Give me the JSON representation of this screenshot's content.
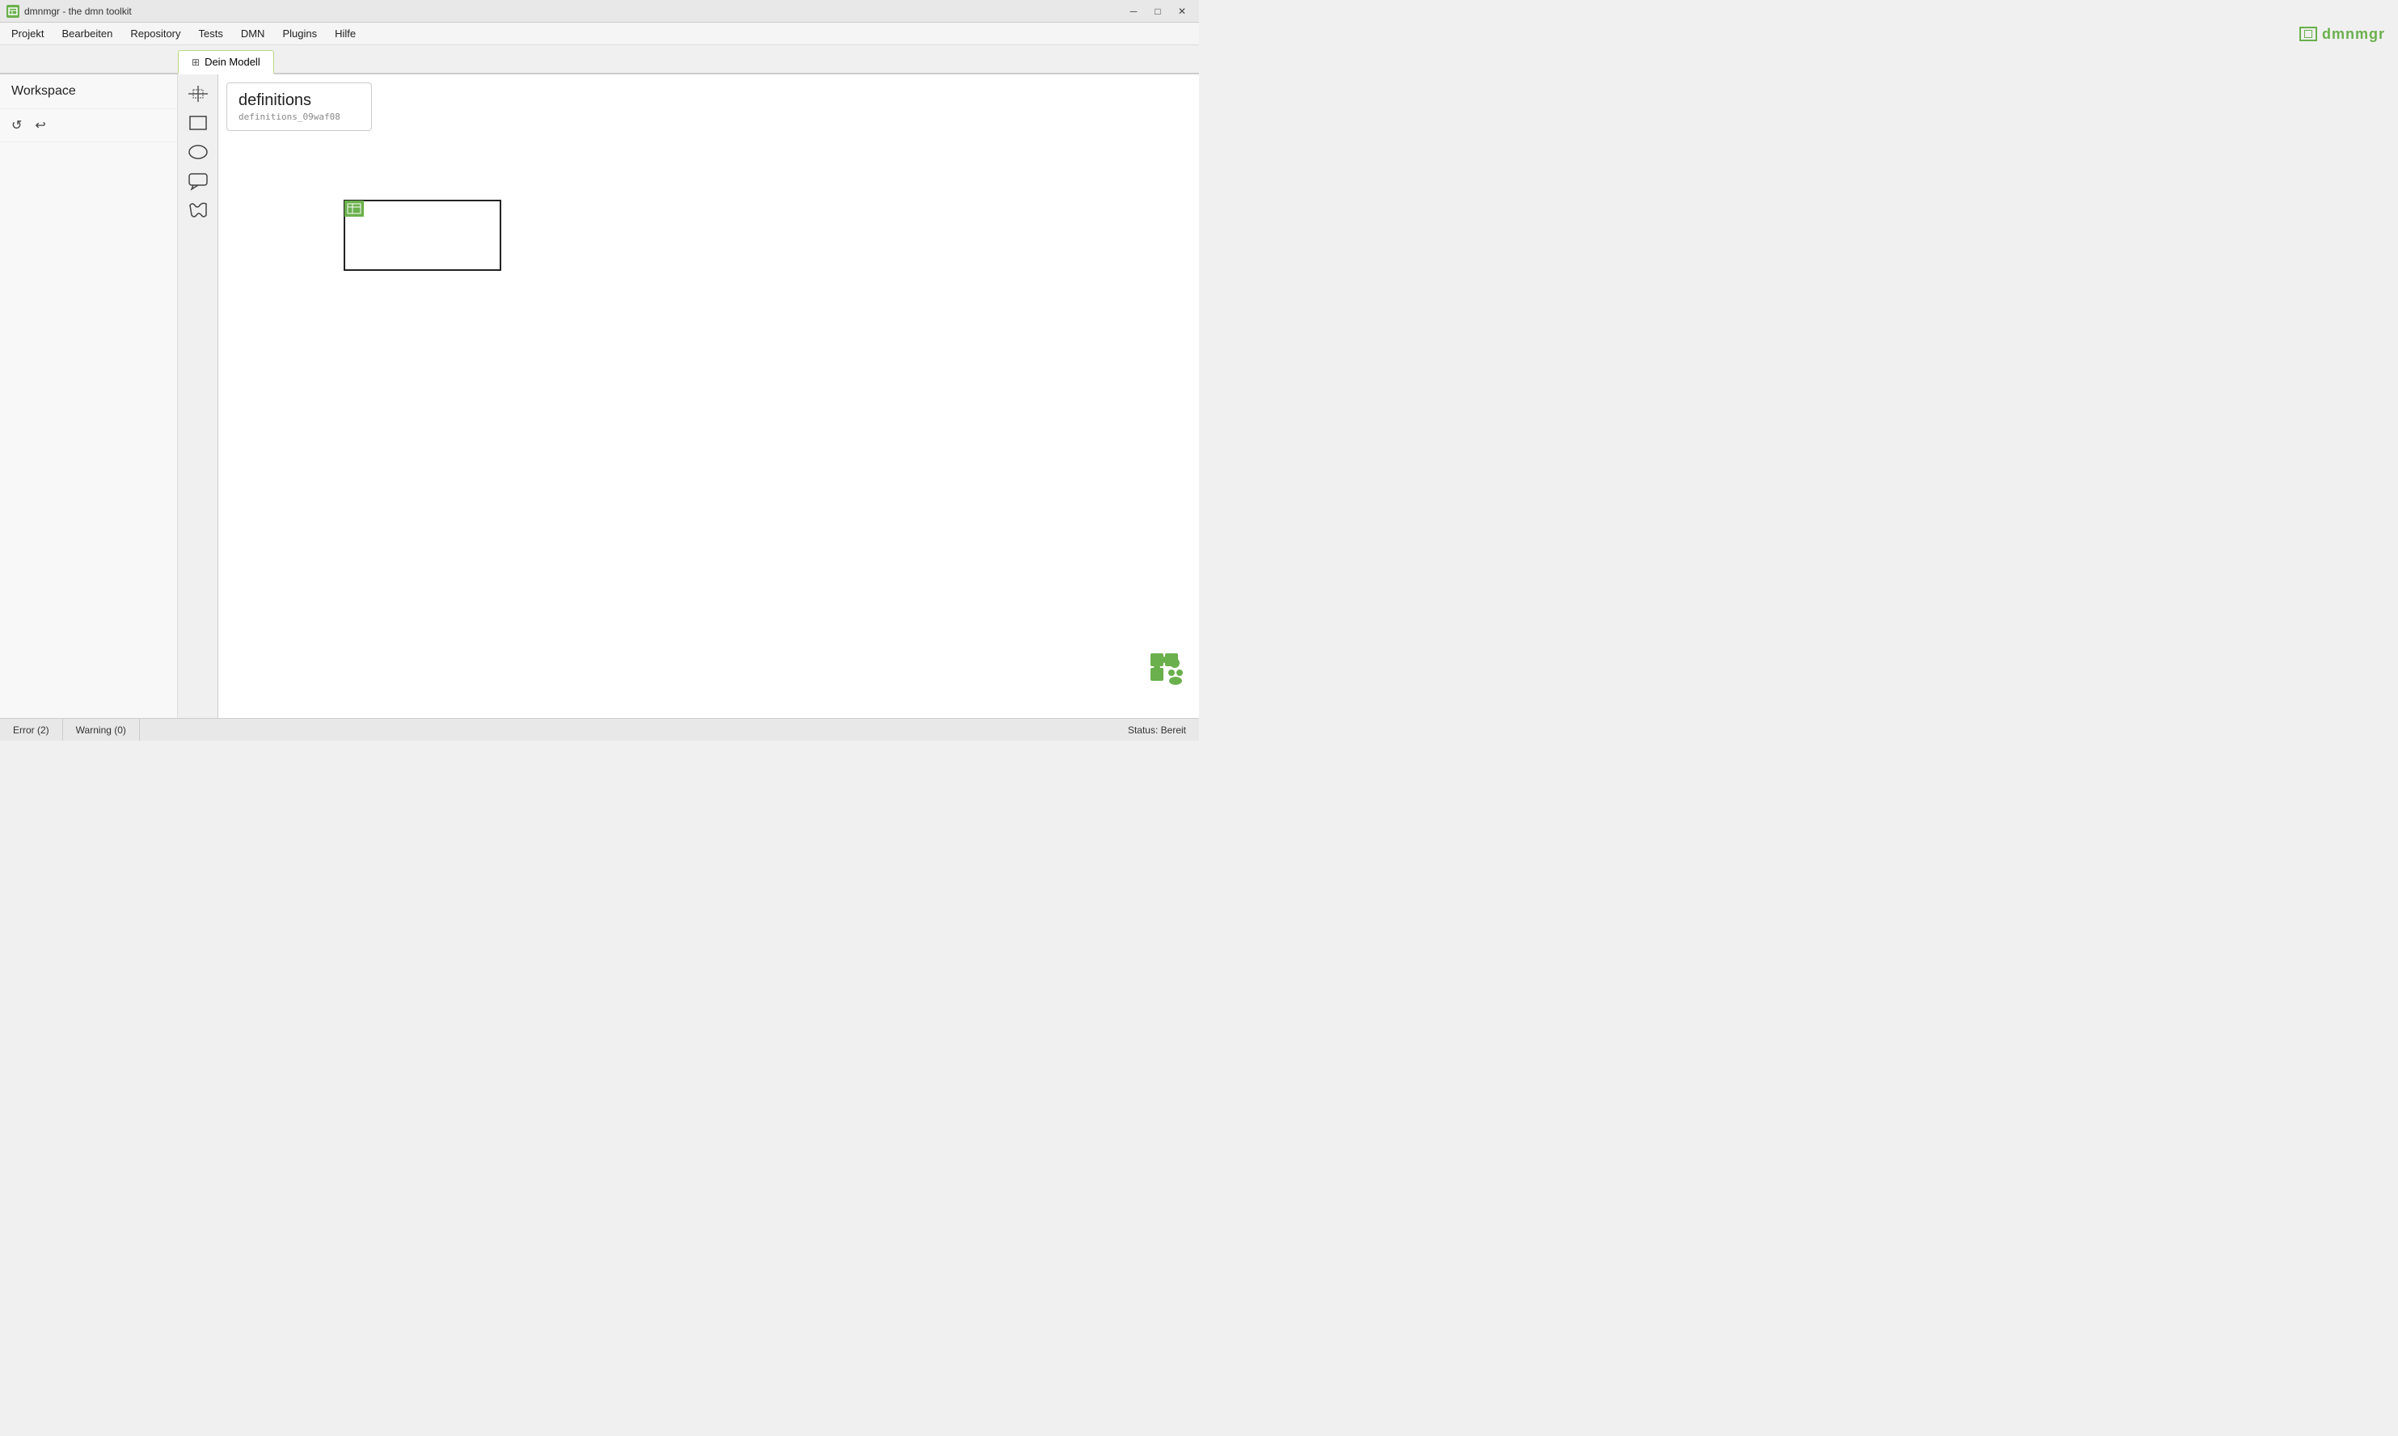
{
  "app": {
    "title": "dmnmgr - the dmn toolkit",
    "icon_label": "dmn"
  },
  "titlebar": {
    "minimize_label": "─",
    "maximize_label": "□",
    "close_label": "✕"
  },
  "menubar": {
    "items": [
      {
        "label": "Projekt"
      },
      {
        "label": "Bearbeiten"
      },
      {
        "label": "Repository"
      },
      {
        "label": "Tests"
      },
      {
        "label": "DMN"
      },
      {
        "label": "Plugins"
      },
      {
        "label": "Hilfe"
      }
    ]
  },
  "brand": {
    "name": "dmnmgr"
  },
  "tabs": [
    {
      "label": "Dein Modell",
      "active": true
    }
  ],
  "left_panel": {
    "workspace_label": "Workspace",
    "refresh_icon": "↺",
    "undo_icon": "↩"
  },
  "shapes": [
    {
      "name": "crosshair"
    },
    {
      "name": "rectangle"
    },
    {
      "name": "ellipse"
    },
    {
      "name": "callout"
    },
    {
      "name": "wave-rect"
    }
  ],
  "canvas": {
    "definitions_title": "definitions",
    "definitions_id": "definitions_09waf08"
  },
  "statusbar": {
    "error_label": "Error (2)",
    "warning_label": "Warning (0)",
    "status_label": "Status: Bereit"
  }
}
